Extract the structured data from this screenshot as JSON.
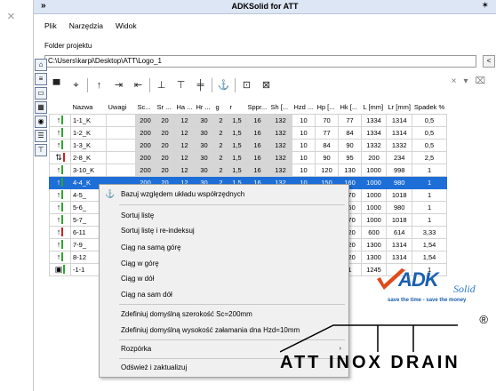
{
  "window": {
    "title": "ADKSolid for ATT",
    "collapse_glyph": "»",
    "pin_glyph": "✶",
    "outer_close": "×"
  },
  "menu": [
    "Plik",
    "Narzędzia",
    "Widok"
  ],
  "folder": {
    "label": "Folder projektu",
    "path": "C:\\Users\\karpi\\Desktop\\ATT\\Logo_1",
    "browse": "<"
  },
  "toolbar_right": {
    "close": "×",
    "dropdown": "▾"
  },
  "table": {
    "headers": [
      "",
      "Nazwa",
      "Uwagi",
      "Sc...",
      "Sr ...",
      "Ha ...",
      "Hr ...",
      "g",
      "r",
      "Sppr...",
      "Sh [...",
      "Hzd ...",
      "Hp [...",
      "Hk [...",
      "L [mm]",
      "Lr [mm]",
      "Spadek %"
    ],
    "rows": [
      {
        "ind": "↑",
        "bar": "#2aa82a",
        "cells": [
          "1-1_K",
          "",
          "200",
          "20",
          "12",
          "30",
          "2",
          "1,5",
          "16",
          "132",
          "10",
          "70",
          "77",
          "1334",
          "1314",
          "0,5"
        ]
      },
      {
        "ind": "↑",
        "bar": "#2aa82a",
        "cells": [
          "1-2_K",
          "",
          "200",
          "20",
          "12",
          "30",
          "2",
          "1,5",
          "16",
          "132",
          "10",
          "77",
          "84",
          "1334",
          "1314",
          "0,5"
        ]
      },
      {
        "ind": "↑",
        "bar": "#2aa82a",
        "cells": [
          "1-3_K",
          "",
          "200",
          "20",
          "12",
          "30",
          "2",
          "1,5",
          "16",
          "132",
          "10",
          "84",
          "90",
          "1332",
          "1332",
          "0,5"
        ]
      },
      {
        "ind": "⇅",
        "bar": "#d02020",
        "cells": [
          "2-8_K",
          "",
          "200",
          "20",
          "12",
          "30",
          "2",
          "1,5",
          "16",
          "132",
          "10",
          "90",
          "95",
          "200",
          "234",
          "2,5"
        ]
      },
      {
        "ind": "↑",
        "bar": "#2aa82a",
        "cells": [
          "3-10_K",
          "",
          "200",
          "20",
          "12",
          "30",
          "2",
          "1,5",
          "16",
          "132",
          "10",
          "120",
          "130",
          "1000",
          "998",
          "1"
        ]
      },
      {
        "ind": "↑",
        "bar": "#2aa82a",
        "sel": true,
        "cells": [
          "4-4_K",
          "",
          "200",
          "20",
          "12",
          "30",
          "2",
          "1,5",
          "16",
          "132",
          "10",
          "150",
          "160",
          "1000",
          "980",
          "1"
        ]
      },
      {
        "ind": "↑",
        "bar": "#2aa82a",
        "cells": [
          "4-5_",
          "",
          "",
          "",
          "",
          "",
          "",
          "",
          "",
          "",
          "10",
          "160",
          "170",
          "1000",
          "1018",
          "1"
        ]
      },
      {
        "ind": "↑",
        "bar": "#2aa82a",
        "cells": [
          "5-6_",
          "",
          "",
          "",
          "",
          "",
          "",
          "",
          "",
          "",
          "10",
          "150",
          "160",
          "1000",
          "980",
          "1"
        ]
      },
      {
        "ind": "↑",
        "bar": "#2aa82a",
        "cells": [
          "5-7_",
          "",
          "",
          "",
          "",
          "",
          "",
          "",
          "",
          "",
          "10",
          "160",
          "170",
          "1000",
          "1018",
          "1"
        ]
      },
      {
        "ind": "↑",
        "bar": "#d02020",
        "cells": [
          "6-11",
          "",
          "",
          "",
          "",
          "",
          "",
          "",
          "",
          "",
          "10",
          "100",
          "120",
          "600",
          "614",
          "3,33"
        ]
      },
      {
        "ind": "↑",
        "bar": "#2aa82a",
        "cells": [
          "7-9_",
          "",
          "",
          "",
          "",
          "",
          "",
          "",
          "",
          "",
          "10",
          "100",
          "120",
          "1300",
          "1314",
          "1,54"
        ]
      },
      {
        "ind": "↑",
        "bar": "#2aa82a",
        "cells": [
          "8-12",
          "",
          "",
          "",
          "",
          "",
          "",
          "",
          "",
          "",
          "10",
          "100",
          "120",
          "1300",
          "1314",
          "1,54"
        ]
      },
      {
        "ind": "▣",
        "bar": "#2aa82a",
        "cells": [
          "-1-1",
          "",
          "",
          "",
          "",
          "",
          "",
          "",
          "",
          "",
          "10",
          "180",
          "1",
          "1245",
          "",
          "1"
        ]
      }
    ]
  },
  "context_menu": {
    "items": [
      "Bazuj względem układu współrzędnych",
      "Sortuj listę",
      "Sortuj listę i re-indeksuj",
      "Ciąg na samą górę",
      "Ciąg w górę",
      "Ciąg w dół",
      "Ciąg na sam dół",
      "Zdefiniuj domyślną szerokość Sc=200mm",
      "Zdefiniuj domyślną wysokość załamania dna Hzd=10mm",
      "Rozpórka",
      "Odśwież i zaktualizuj"
    ],
    "submenu_glyph": "›"
  },
  "logos": {
    "adk": "ADK",
    "solid": "Solid",
    "slogan": "save the time - save the money",
    "att": "ATT INOX DRAIN",
    "reg": "®"
  }
}
